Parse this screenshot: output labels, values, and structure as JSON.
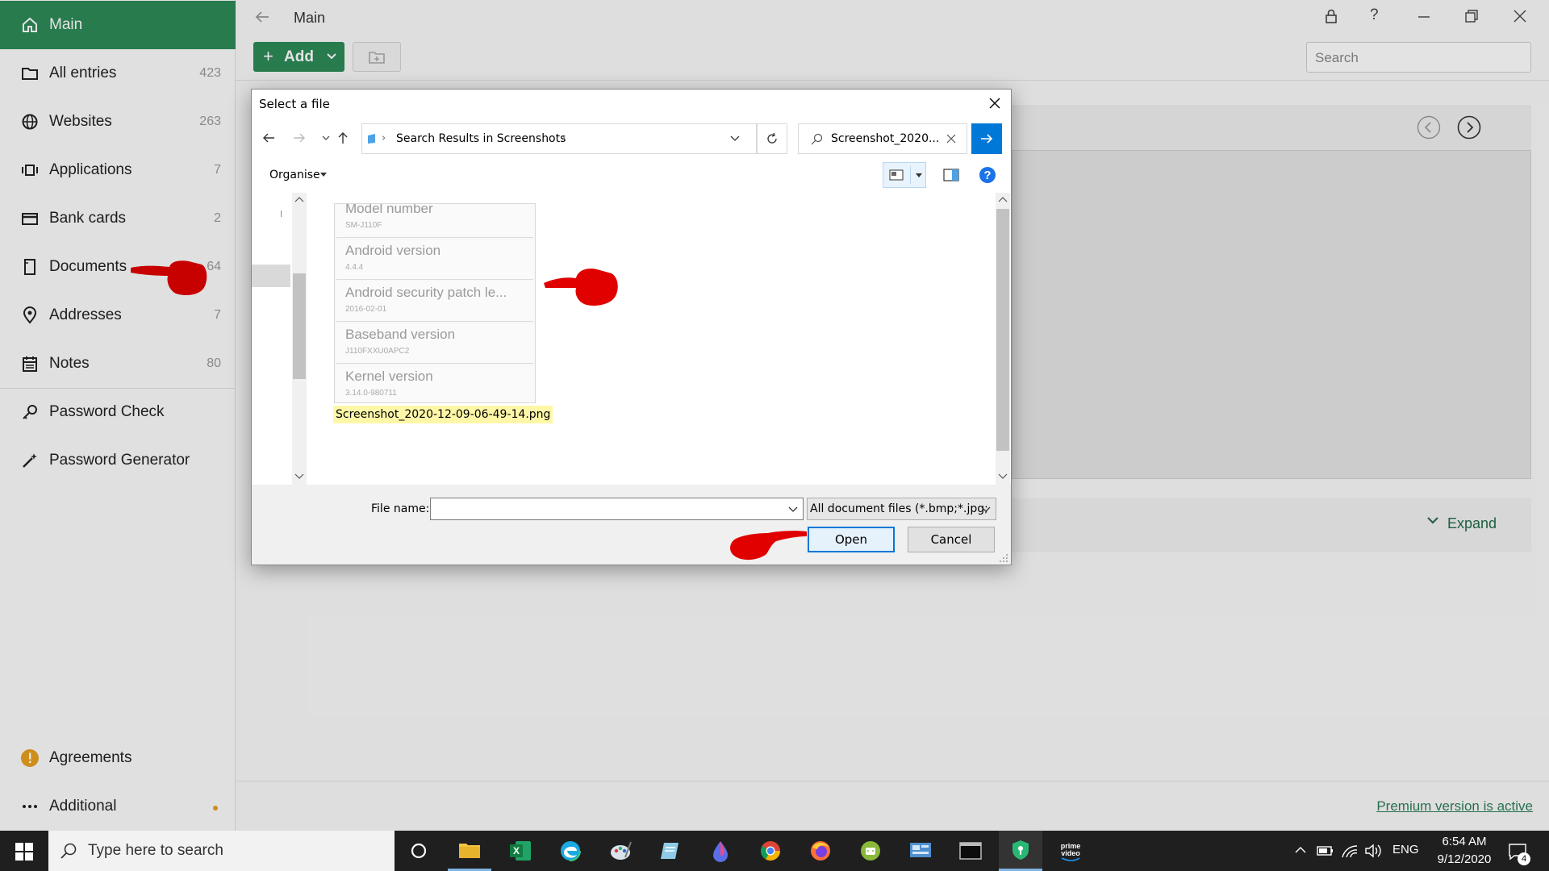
{
  "window": {
    "title": "Main"
  },
  "colors": {
    "accent": "#2e8b57",
    "annotation": "#e00000",
    "dialog_accent": "#0078d7"
  },
  "sidebar": {
    "items": [
      {
        "label": "Main",
        "count": "",
        "icon": "home-icon"
      },
      {
        "label": "All entries",
        "count": "423",
        "icon": "folder-icon"
      },
      {
        "label": "Websites",
        "count": "263",
        "icon": "globe-icon"
      },
      {
        "label": "Applications",
        "count": "7",
        "icon": "applications-icon"
      },
      {
        "label": "Bank cards",
        "count": "2",
        "icon": "bank-card-icon"
      },
      {
        "label": "Documents",
        "count": "64",
        "icon": "document-icon"
      },
      {
        "label": "Addresses",
        "count": "7",
        "icon": "location-pin-icon"
      },
      {
        "label": "Notes",
        "count": "80",
        "icon": "notes-icon"
      },
      {
        "label": "Password Check",
        "count": "",
        "icon": "key-icon"
      },
      {
        "label": "Password Generator",
        "count": "",
        "icon": "magic-wand-icon"
      }
    ],
    "agreements": "Agreements",
    "additional": "Additional"
  },
  "toolbar": {
    "add_label": "Add",
    "search_placeholder": "Search"
  },
  "content": {
    "expand_label": "Expand",
    "premium_text": "Premium version is active"
  },
  "dialog": {
    "title": "Select a file",
    "breadcrumb": "Search Results in Screenshots",
    "search_value": "Screenshot_2020...",
    "organise": "Organise",
    "thumbnail_rows": [
      {
        "title": "Model number",
        "sub": "SM-J110F"
      },
      {
        "title": "Android version",
        "sub": "4.4.4"
      },
      {
        "title": "Android security patch le...",
        "sub": "2016-02-01"
      },
      {
        "title": "Baseband version",
        "sub": "J110FXXU0APC2"
      },
      {
        "title": "Kernel version",
        "sub": "3.14.0-980711"
      }
    ],
    "file_label": "Screenshot_2020-12-09-06-49-14.png",
    "file_name_label": "File name:",
    "file_name_value": "",
    "file_type": "All document files (*.bmp;*.jpg;",
    "open_label": "Open",
    "cancel_label": "Cancel"
  },
  "taskbar": {
    "search_placeholder": "Type here to search",
    "language": "ENG",
    "time": "6:54 AM",
    "date": "9/12/2020",
    "notification_count": "4",
    "apps": [
      "cortana-icon",
      "file-explorer-icon",
      "excel-icon",
      "edge-icon",
      "paint-icon",
      "notepad-icon",
      "drop-icon",
      "chrome-icon",
      "firefox-icon",
      "android-icon",
      "control-panel-icon",
      "terminal-icon",
      "kaspersky-icon",
      "prime-video-icon"
    ]
  }
}
